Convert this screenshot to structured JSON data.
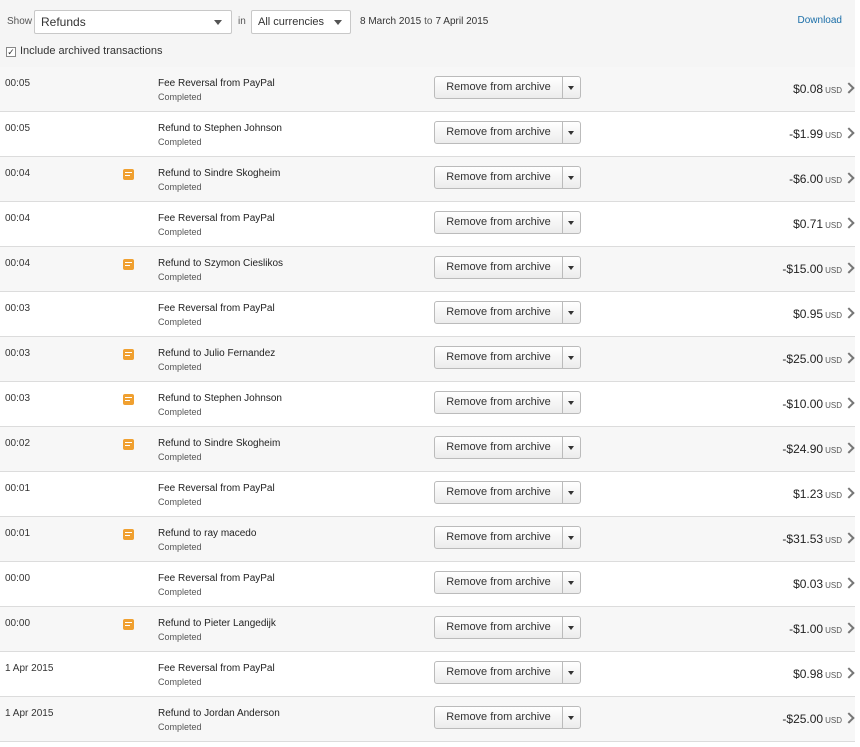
{
  "filters": {
    "show_label": "Show",
    "type_value": "Refunds",
    "in_label": "in",
    "currency_value": "All currencies",
    "date_from": "8 March 2015",
    "date_to_label": "to",
    "date_to": "7 April 2015",
    "download_label": "Download",
    "archived_label": "Include archived transactions",
    "archived_checked": true
  },
  "button_label": "Remove from archive",
  "currency_code": "USD",
  "transactions": [
    {
      "time": "00:05",
      "note": false,
      "title": "Fee Reversal from PayPal",
      "status": "Completed",
      "amount": "$0.08"
    },
    {
      "time": "00:05",
      "note": false,
      "title": "Refund to Stephen Johnson",
      "status": "Completed",
      "amount": "-$1.99"
    },
    {
      "time": "00:04",
      "note": true,
      "title": "Refund to Sindre Skogheim",
      "status": "Completed",
      "amount": "-$6.00"
    },
    {
      "time": "00:04",
      "note": false,
      "title": "Fee Reversal from PayPal",
      "status": "Completed",
      "amount": "$0.71"
    },
    {
      "time": "00:04",
      "note": true,
      "title": "Refund to Szymon Cieslikos",
      "status": "Completed",
      "amount": "-$15.00"
    },
    {
      "time": "00:03",
      "note": false,
      "title": "Fee Reversal from PayPal",
      "status": "Completed",
      "amount": "$0.95"
    },
    {
      "time": "00:03",
      "note": true,
      "title": "Refund to Julio Fernandez",
      "status": "Completed",
      "amount": "-$25.00"
    },
    {
      "time": "00:03",
      "note": true,
      "title": "Refund to Stephen Johnson",
      "status": "Completed",
      "amount": "-$10.00"
    },
    {
      "time": "00:02",
      "note": true,
      "title": "Refund to Sindre Skogheim",
      "status": "Completed",
      "amount": "-$24.90"
    },
    {
      "time": "00:01",
      "note": false,
      "title": "Fee Reversal from PayPal",
      "status": "Completed",
      "amount": "$1.23"
    },
    {
      "time": "00:01",
      "note": true,
      "title": "Refund to ray macedo",
      "status": "Completed",
      "amount": "-$31.53"
    },
    {
      "time": "00:00",
      "note": false,
      "title": "Fee Reversal from PayPal",
      "status": "Completed",
      "amount": "$0.03"
    },
    {
      "time": "00:00",
      "note": true,
      "title": "Refund to Pieter Langedijk",
      "status": "Completed",
      "amount": "-$1.00"
    },
    {
      "time": "1 Apr 2015",
      "note": false,
      "title": "Fee Reversal from PayPal",
      "status": "Completed",
      "amount": "$0.98"
    },
    {
      "time": "1 Apr 2015",
      "note": false,
      "title": "Refund to Jordan Anderson",
      "status": "Completed",
      "amount": "-$25.00"
    }
  ]
}
